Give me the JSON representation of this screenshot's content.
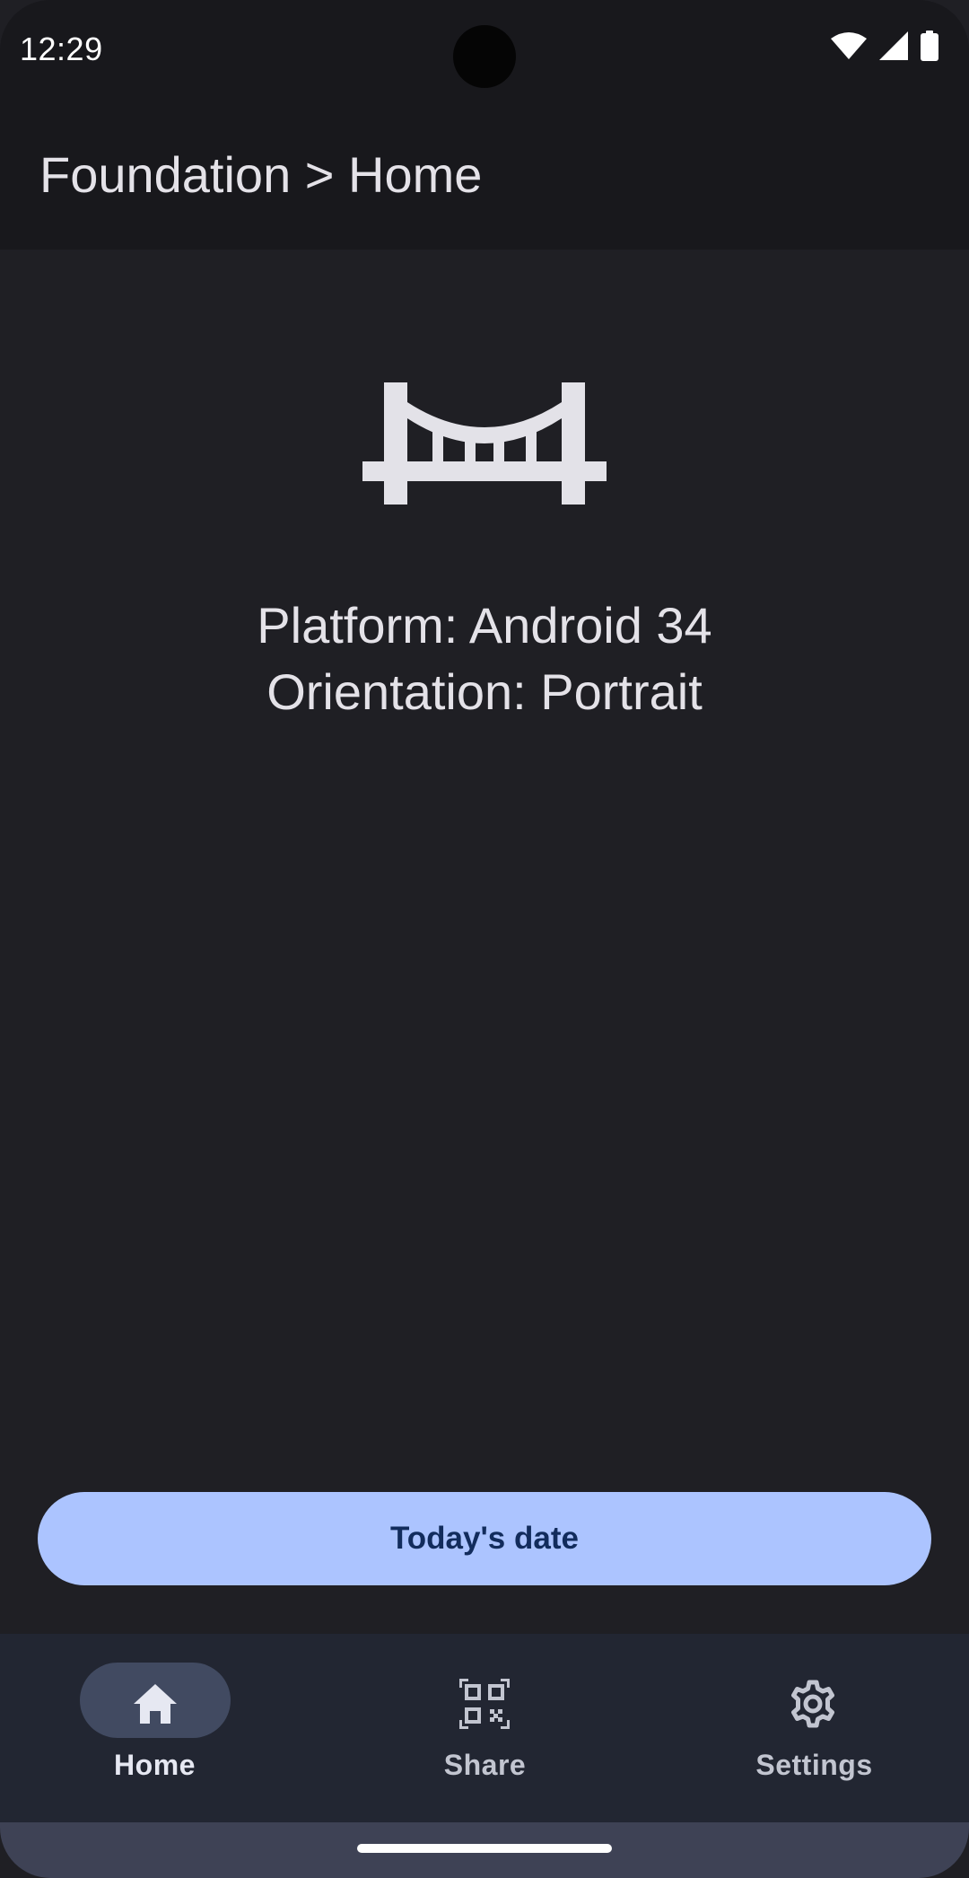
{
  "status_bar": {
    "time": "12:29",
    "icons": [
      "wifi-icon",
      "cellular-signal-icon",
      "battery-icon"
    ]
  },
  "app_bar": {
    "title": "Foundation > Home"
  },
  "main": {
    "hero_icon": "bridge-icon",
    "platform_text": "Platform: Android 34",
    "orientation_text": "Orientation: Portrait",
    "date_button_label": "Today's date"
  },
  "bottom_nav": {
    "items": [
      {
        "label": "Home",
        "icon": "home-icon",
        "selected": true
      },
      {
        "label": "Share",
        "icon": "qr-code-icon",
        "selected": false
      },
      {
        "label": "Settings",
        "icon": "gear-icon",
        "selected": false
      }
    ]
  },
  "colors": {
    "background": "#1f1f24",
    "app_bar": "#18181c",
    "button": "#acc4ff",
    "button_text": "#122c5c",
    "nav_background": "#222632",
    "nav_indicator": "#414a61"
  }
}
